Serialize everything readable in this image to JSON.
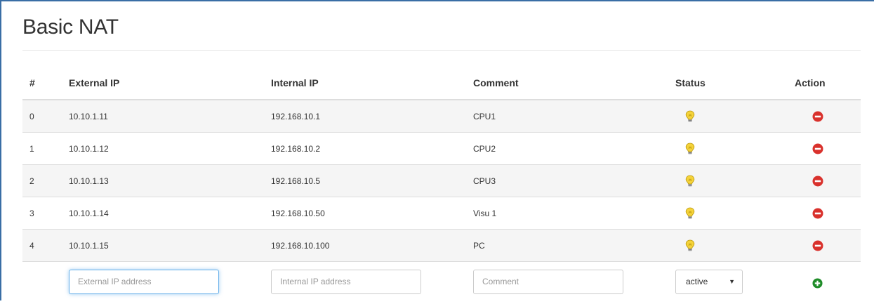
{
  "title": "Basic NAT",
  "columns": {
    "index": "#",
    "external_ip": "External IP",
    "internal_ip": "Internal IP",
    "comment": "Comment",
    "status": "Status",
    "action": "Action"
  },
  "rows": [
    {
      "index": "0",
      "external_ip": "10.10.1.11",
      "internal_ip": "192.168.10.1",
      "comment": "CPU1",
      "status": "active"
    },
    {
      "index": "1",
      "external_ip": "10.10.1.12",
      "internal_ip": "192.168.10.2",
      "comment": "CPU2",
      "status": "active"
    },
    {
      "index": "2",
      "external_ip": "10.10.1.13",
      "internal_ip": "192.168.10.5",
      "comment": "CPU3",
      "status": "active"
    },
    {
      "index": "3",
      "external_ip": "10.10.1.14",
      "internal_ip": "192.168.10.50",
      "comment": "Visu 1",
      "status": "active"
    },
    {
      "index": "4",
      "external_ip": "10.10.1.15",
      "internal_ip": "192.168.10.100",
      "comment": "PC",
      "status": "active"
    }
  ],
  "form": {
    "external_ip_placeholder": "External IP address",
    "internal_ip_placeholder": "Internal IP address",
    "comment_placeholder": "Comment",
    "status_selected": "active"
  },
  "icons": {
    "status": "lightbulb-icon",
    "delete": "minus-circle-icon",
    "add": "plus-circle-icon"
  },
  "colors": {
    "frame_border": "#3a6ea5",
    "delete_red": "#d9312c",
    "add_green": "#1e8c28",
    "bulb_yellow": "#f5d33a",
    "focus_blue": "#66afe9"
  }
}
